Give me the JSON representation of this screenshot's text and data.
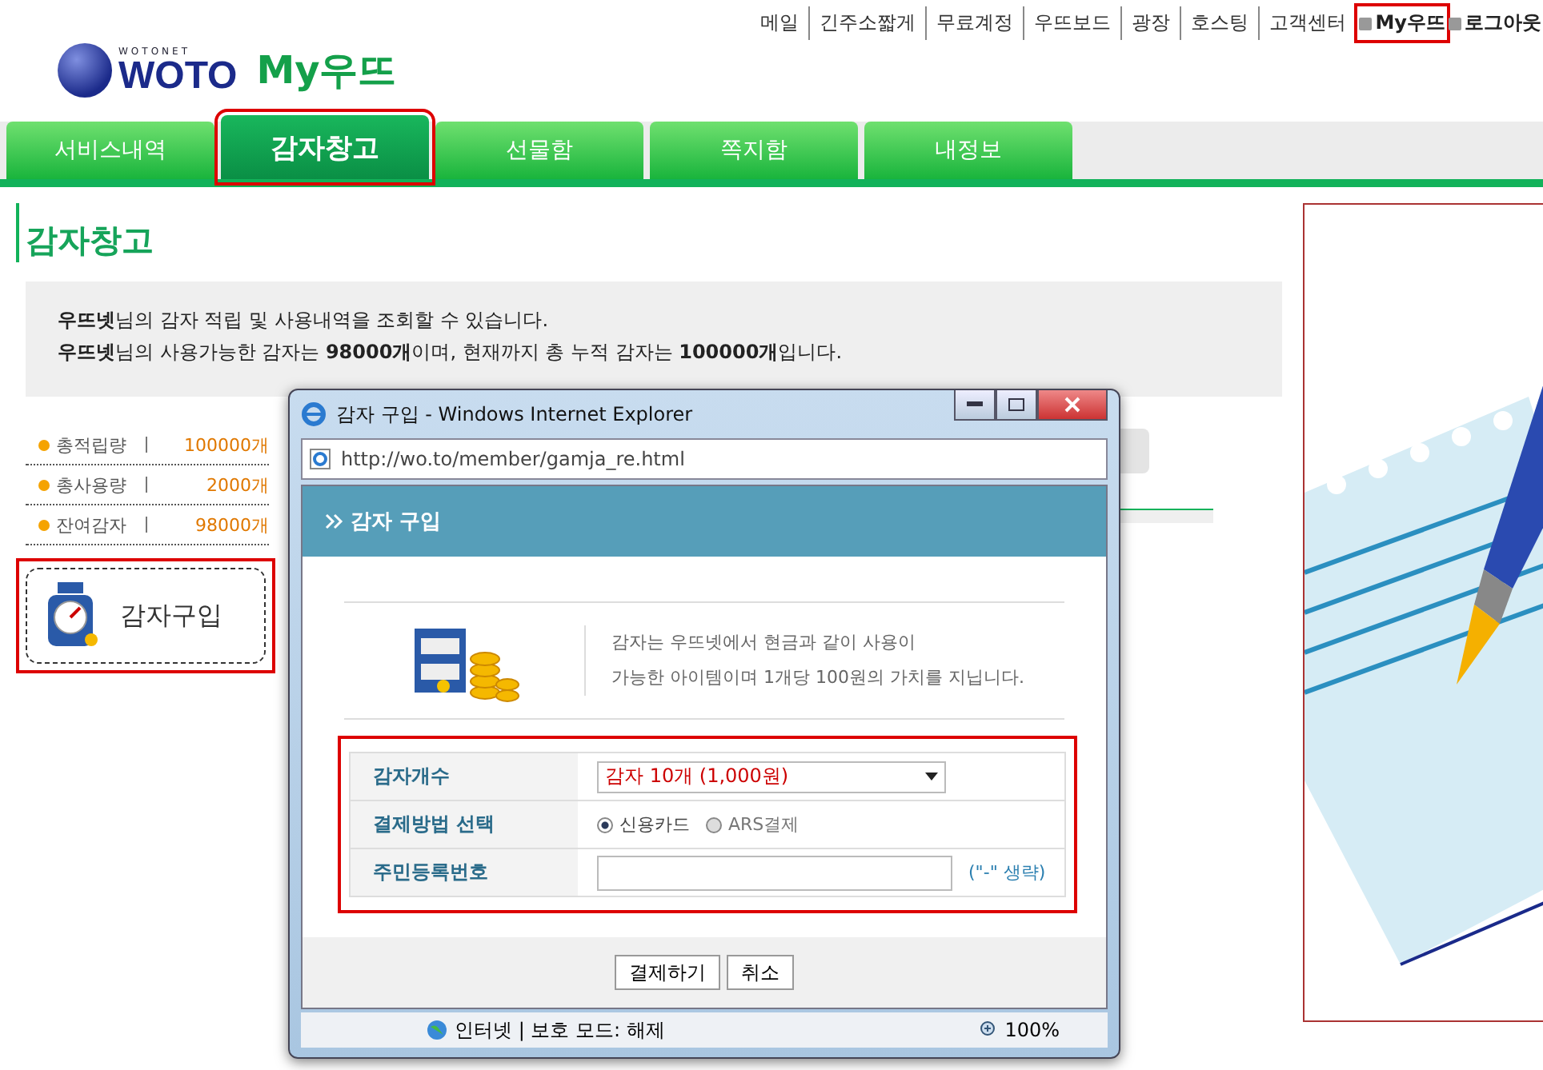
{
  "header": {
    "logo_sub": "WOTONET",
    "logo": "WOTO",
    "title": "My우뜨"
  },
  "top_links": [
    {
      "label": "메일",
      "kind": "plain",
      "annotated": false
    },
    {
      "label": "긴주소짧게",
      "kind": "plain",
      "annotated": false
    },
    {
      "label": "무료계정",
      "kind": "plain",
      "annotated": false
    },
    {
      "label": "우뜨보드",
      "kind": "plain",
      "annotated": false
    },
    {
      "label": "광장",
      "kind": "plain",
      "annotated": false
    },
    {
      "label": "호스팅",
      "kind": "plain",
      "annotated": false
    },
    {
      "label": "고객센터",
      "kind": "plain",
      "annotated": false
    },
    {
      "label": "My우뜨",
      "kind": "bullet",
      "annotated": true
    },
    {
      "label": "로그아웃",
      "kind": "bullet",
      "annotated": false
    }
  ],
  "tabs": [
    {
      "label": "서비스내역",
      "selected": false
    },
    {
      "label": "감자창고",
      "selected": true
    },
    {
      "label": "선물함",
      "selected": false
    },
    {
      "label": "쪽지함",
      "selected": false
    },
    {
      "label": "내정보",
      "selected": false
    }
  ],
  "page_title": "감자창고",
  "info_lines": [
    "**우뜨넷**님의 감자 적립 및 사용내역을 조회할 수 있습니다.",
    "**우뜨넷**님의 사용가능한 감자는 **98000개**이며, 현재까지 총 누적 감자는 **100000개**입니다."
  ],
  "stats": [
    {
      "label": "총적립량",
      "value": "100000개"
    },
    {
      "label": "총사용량",
      "value": "2000개"
    },
    {
      "label": "잔여감자",
      "value": "98000개"
    }
  ],
  "buy_button": {
    "label": "감자구입",
    "annotated": true
  },
  "popup": {
    "title": "감자 구입 - Windows Internet Explorer",
    "address": "http://wo.to/member/gamja_re.html",
    "heading": "감자 구입",
    "intro": [
      "감자는 우뜨넷에서 현금과 같이 사용이",
      "가능한 아이템이며 1개당 100원의 가치를 지닙니다."
    ],
    "form_annotated": true,
    "rows": [
      {
        "kind": "select",
        "label": "감자개수",
        "value": "감자 10개 (1,000원)"
      },
      {
        "kind": "radio",
        "label": "결제방법 선택",
        "options": [
          {
            "label": "신용카드",
            "selected": true
          },
          {
            "label": "ARS결제",
            "selected": false
          }
        ]
      },
      {
        "kind": "input",
        "label": "주민등록번호",
        "note": "(\"-\" 생략)"
      }
    ],
    "buttons": [
      "결제하기",
      "취소"
    ],
    "status": {
      "zone": "인터넷 | 보호 모드: 해제",
      "zoom": "100%"
    }
  }
}
